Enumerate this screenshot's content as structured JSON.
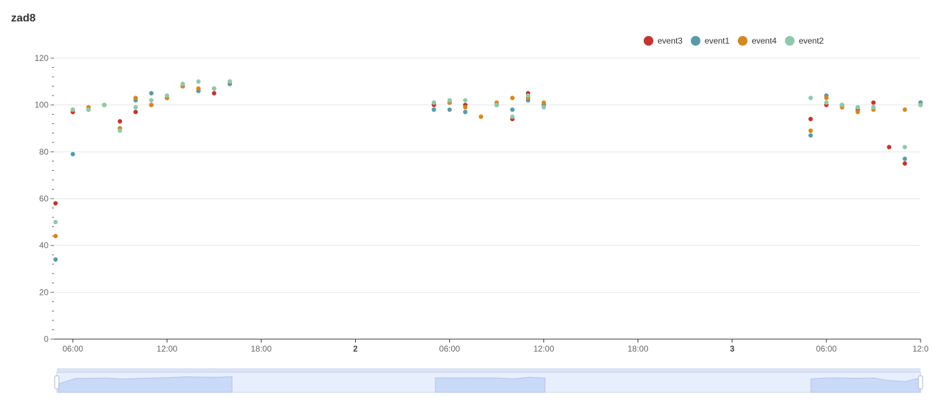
{
  "chart_data": {
    "type": "scatter",
    "title": "zad8",
    "xlabel": "",
    "ylabel": "",
    "ylim": [
      0,
      120
    ],
    "y_ticks": [
      0,
      20,
      40,
      60,
      80,
      100,
      120
    ],
    "x_range_hours": [
      4.8,
      60.0
    ],
    "x_ticks": [
      {
        "hour": 6,
        "label": "06:00"
      },
      {
        "hour": 12,
        "label": "12:00"
      },
      {
        "hour": 18,
        "label": "18:00"
      },
      {
        "hour": 24,
        "label": "2"
      },
      {
        "hour": 30,
        "label": "06:00"
      },
      {
        "hour": 36,
        "label": "12:00"
      },
      {
        "hour": 42,
        "label": "18:00"
      },
      {
        "hour": 48,
        "label": "3"
      },
      {
        "hour": 54,
        "label": "06:00"
      },
      {
        "hour": 60,
        "label": "12:0"
      }
    ],
    "grid": true,
    "legend_position": "top-right",
    "data_zoom": true,
    "series": [
      {
        "name": "event3",
        "color": "#c23531",
        "points": [
          [
            4.9,
            58
          ],
          [
            6,
            97
          ],
          [
            7,
            98
          ],
          [
            8,
            100
          ],
          [
            9,
            93
          ],
          [
            10,
            97
          ],
          [
            11,
            100
          ],
          [
            12,
            103
          ],
          [
            13,
            108
          ],
          [
            14,
            106
          ],
          [
            15,
            105
          ],
          [
            16,
            109
          ],
          [
            29,
            100
          ],
          [
            30,
            101
          ],
          [
            31,
            100
          ],
          [
            33,
            100
          ],
          [
            34,
            94
          ],
          [
            35,
            105
          ],
          [
            36,
            100
          ],
          [
            53,
            94
          ],
          [
            54,
            100
          ],
          [
            55,
            100
          ],
          [
            56,
            98
          ],
          [
            57,
            101
          ],
          [
            58,
            82
          ],
          [
            59,
            75
          ],
          [
            60,
            101
          ]
        ]
      },
      {
        "name": "event1",
        "color": "#5a9aa8",
        "points": [
          [
            4.9,
            34
          ],
          [
            6,
            79
          ],
          [
            7,
            98
          ],
          [
            8,
            100
          ],
          [
            9,
            90
          ],
          [
            10,
            102
          ],
          [
            11,
            105
          ],
          [
            12,
            103
          ],
          [
            13,
            108
          ],
          [
            14,
            106
          ],
          [
            15,
            107
          ],
          [
            16,
            109
          ],
          [
            29,
            98
          ],
          [
            30,
            98
          ],
          [
            31,
            97
          ],
          [
            33,
            100
          ],
          [
            34,
            98
          ],
          [
            35,
            102
          ],
          [
            36,
            100
          ],
          [
            53,
            87
          ],
          [
            54,
            104
          ],
          [
            55,
            100
          ],
          [
            56,
            99
          ],
          [
            57,
            99
          ],
          [
            59,
            77
          ],
          [
            60,
            101
          ]
        ]
      },
      {
        "name": "event4",
        "color": "#d48821",
        "points": [
          [
            4.9,
            44
          ],
          [
            6,
            98
          ],
          [
            7,
            99
          ],
          [
            8,
            100
          ],
          [
            9,
            90
          ],
          [
            10,
            103
          ],
          [
            11,
            100
          ],
          [
            12,
            103
          ],
          [
            13,
            108
          ],
          [
            14,
            107
          ],
          [
            15,
            107
          ],
          [
            16,
            110
          ],
          [
            29,
            101
          ],
          [
            30,
            101
          ],
          [
            31,
            99
          ],
          [
            32,
            95
          ],
          [
            33,
            101
          ],
          [
            34,
            103
          ],
          [
            35,
            103
          ],
          [
            36,
            101
          ],
          [
            53,
            89
          ],
          [
            54,
            103
          ],
          [
            55,
            99
          ],
          [
            56,
            97
          ],
          [
            57,
            98
          ],
          [
            59,
            98
          ],
          [
            60,
            100
          ]
        ]
      },
      {
        "name": "event2",
        "color": "#91c7ae",
        "points": [
          [
            4.9,
            50
          ],
          [
            6,
            98
          ],
          [
            7,
            98
          ],
          [
            8,
            100
          ],
          [
            9,
            89
          ],
          [
            10,
            99
          ],
          [
            11,
            102
          ],
          [
            12,
            104
          ],
          [
            13,
            109
          ],
          [
            14,
            110
          ],
          [
            15,
            107
          ],
          [
            16,
            110
          ],
          [
            29,
            101
          ],
          [
            30,
            102
          ],
          [
            31,
            102
          ],
          [
            33,
            100
          ],
          [
            34,
            95
          ],
          [
            35,
            104
          ],
          [
            36,
            99
          ],
          [
            53,
            103
          ],
          [
            54,
            101
          ],
          [
            55,
            100
          ],
          [
            56,
            99
          ],
          [
            57,
            99
          ],
          [
            59,
            82
          ],
          [
            60,
            100
          ]
        ]
      }
    ]
  }
}
